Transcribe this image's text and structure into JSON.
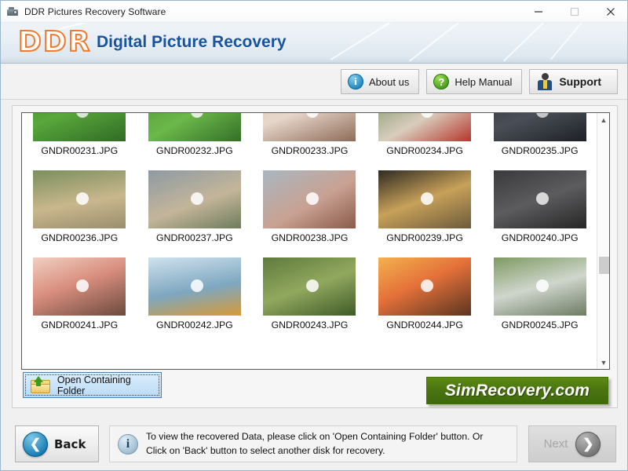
{
  "window": {
    "title": "DDR Pictures Recovery Software",
    "icon": "camera-icon",
    "minimize": "minimize",
    "maximize": "maximize",
    "close": "close"
  },
  "banner": {
    "logo": "DDR",
    "subtitle": "Digital Picture Recovery",
    "logo_color": "#f07a2a",
    "subtitle_color": "#17539e"
  },
  "toolbar": {
    "about_label": "About us",
    "about_icon": "info-icon",
    "help_label": "Help Manual",
    "help_icon": "question-icon",
    "support_label": "Support",
    "support_icon": "person-icon"
  },
  "file_list": {
    "files": [
      {
        "name": "GNDR00231.JPG",
        "thumb": "soccer-ball-grass"
      },
      {
        "name": "GNDR00232.JPG",
        "thumb": "soccer-ball-grass-2"
      },
      {
        "name": "GNDR00233.JPG",
        "thumb": "shopping-street"
      },
      {
        "name": "GNDR00234.JPG",
        "thumb": "red-phonebooth"
      },
      {
        "name": "GNDR00235.JPG",
        "thumb": "group-dark"
      },
      {
        "name": "GNDR00236.JPG",
        "thumb": "friends-park-autumn"
      },
      {
        "name": "GNDR00237.JPG",
        "thumb": "playground-swing"
      },
      {
        "name": "GNDR00238.JPG",
        "thumb": "pink-umbrella-street"
      },
      {
        "name": "GNDR00239.JPG",
        "thumb": "winter-lights-girl"
      },
      {
        "name": "GNDR00240.JPG",
        "thumb": "formal-group-sofa"
      },
      {
        "name": "GNDR00241.JPG",
        "thumb": "friends-sunset-beach"
      },
      {
        "name": "GNDR00242.JPG",
        "thumb": "kayak-lake"
      },
      {
        "name": "GNDR00243.JPG",
        "thumb": "forest-picnic"
      },
      {
        "name": "GNDR00244.JPG",
        "thumb": "sunset-silhouette-tree"
      },
      {
        "name": "GNDR00245.JPG",
        "thumb": "waterfall-walkway"
      }
    ],
    "scroll_up": "scroll-up",
    "scroll_down": "scroll-down"
  },
  "actions": {
    "open_folder_label": "Open Containing Folder",
    "open_folder_icon": "folder-up-icon",
    "brand_logo": "SimRecovery.com",
    "brand_color": "#4a7410"
  },
  "footer": {
    "back_label": "Back",
    "back_icon": "chevron-left-icon",
    "status_icon": "info-icon",
    "status_line1": "To view the recovered Data, please click on 'Open Containing Folder' button. Or",
    "status_line2": "Click on 'Back' button to select another disk for recovery.",
    "next_label": "Next",
    "next_icon": "chevron-right-icon"
  }
}
